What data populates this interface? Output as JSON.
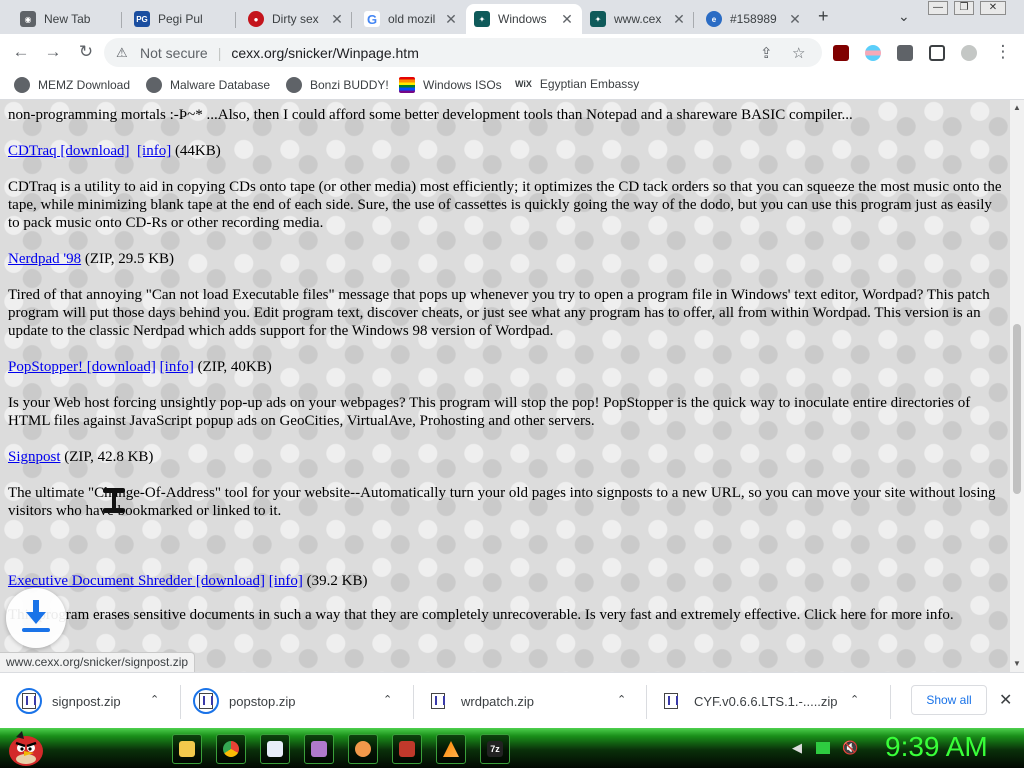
{
  "browser": {
    "tabs": [
      {
        "title": "New Tab",
        "color": "#5f6368",
        "glyph": "◉",
        "active": false
      },
      {
        "title": "Pegi Pul",
        "color": "#1a4ea0",
        "glyph": "PG",
        "active": false
      },
      {
        "title": "Dirty sex",
        "color": "#c4141c",
        "glyph": "●",
        "active": false
      },
      {
        "title": "old mozil",
        "color": "#4285f4",
        "glyph": "G",
        "active": false
      },
      {
        "title": "Windows",
        "color": "#0f5a5a",
        "glyph": "✦",
        "active": true
      },
      {
        "title": "www.cex",
        "color": "#0f5a5a",
        "glyph": "✦",
        "active": false
      },
      {
        "title": "#158989",
        "color": "#2b6cc4",
        "glyph": "e",
        "active": false
      }
    ],
    "new_tab_symbol": "+",
    "tab_search_symbol": "⌄",
    "window_buttons": {
      "minimize": "—",
      "restore": "❐",
      "close": "✕"
    },
    "address": {
      "security_label": "Not secure",
      "url": "cexx.org/snicker/Winpage.htm"
    },
    "bookmarks": [
      {
        "label": "MEMZ Download",
        "icon": "globe-icon",
        "color": "#5f6368"
      },
      {
        "label": "Malware Database",
        "icon": "globe-icon",
        "color": "#5f6368"
      },
      {
        "label": "Bonzi BUDDY!",
        "icon": "globe-icon",
        "color": "#5f6368"
      },
      {
        "label": "Windows ISOs",
        "icon": "flag-icon",
        "color": "#e04040"
      },
      {
        "label": "Egyptian Embassy",
        "icon": "wix-icon",
        "color": "#000000"
      }
    ],
    "wix_text": "WiX"
  },
  "page": {
    "top_line": "non-programming mortals :-Þ~* ...Also, then I could afford some better development tools than Notepad and a shareware BASIC compiler...",
    "items": [
      {
        "links": [
          "CDTraq [download]",
          "[info]"
        ],
        "meta": "(44KB)",
        "desc": "CDTraq is a utility to aid in copying CDs onto tape (or other media) most efficiently; it optimizes the CD tack orders so that you can squeeze the most music onto the tape, while minimizing blank tape at the end of each side. Sure, the use of cassettes is quickly going the way of the dodo, but you can use this program just as easily to pack music onto CD-Rs or other recording media."
      },
      {
        "links": [
          "Nerdpad '98"
        ],
        "meta": "(ZIP, 29.5 KB)",
        "desc": "Tired of that annoying \"Can not load Executable files\" message that pops up whenever you try to open a program file in Windows' text editor, Wordpad? This patch program will put those days behind you. Edit program text, discover cheats, or just see what any program has to offer, all from within Wordpad. This version is an update to the classic Nerdpad which adds support for the Windows 98 version of Wordpad."
      },
      {
        "links": [
          "PopStopper! [download]",
          "[info]"
        ],
        "meta": "(ZIP, 40KB)",
        "desc": "Is your Web host forcing unsightly pop-up ads on your webpages? This program will stop the pop! PopStopper is the quick way to inoculate entire directories of HTML files against JavaScript popup ads on GeoCities, VirtualAve, Prohosting and other servers."
      },
      {
        "links": [
          "Signpost"
        ],
        "meta": "(ZIP, 42.8 KB)",
        "desc": "The ultimate \"Change-Of-Address\" tool for your website--Automatically turn your old pages into signposts to a new URL, so you can move your site without losing visitors who have bookmarked or linked to it."
      },
      {
        "links": [
          "Executive Document Shredder [download]",
          "[info]"
        ],
        "meta": "(39.2 KB)",
        "desc": "This program erases sensitive documents in such a way that they are completely unrecoverable. Is very fast and extremely effective. Click here for more info."
      }
    ],
    "status_url": "www.cexx.org/snicker/signpost.zip"
  },
  "downloads": {
    "items": [
      {
        "filename": "signpost.zip",
        "in_progress": true
      },
      {
        "filename": "popstop.zip",
        "in_progress": true
      },
      {
        "filename": "wrdpatch.zip",
        "in_progress": false
      },
      {
        "filename": "CYF.v0.6.6.LTS.1.-.....zip",
        "in_progress": false
      }
    ],
    "show_all_label": "Show all",
    "close_symbol": "✕",
    "chevron": "⌃"
  },
  "taskbar": {
    "apps": [
      {
        "name": "file-explorer-icon",
        "color": "#f2c94c"
      },
      {
        "name": "chrome-icon",
        "color": "#4285f4"
      },
      {
        "name": "document-icon",
        "color": "#e8eef8"
      },
      {
        "name": "bonzi-icon",
        "color": "#b07acc"
      },
      {
        "name": "search-icon",
        "color": "#f2994a"
      },
      {
        "name": "game-icon",
        "color": "#c0392b"
      },
      {
        "name": "vlc-icon",
        "color": "#ff8800"
      },
      {
        "name": "7zip-icon",
        "color": "#222222"
      }
    ],
    "zip_text": "7z",
    "clock": "9:39 AM",
    "accent": "#39ff39"
  }
}
